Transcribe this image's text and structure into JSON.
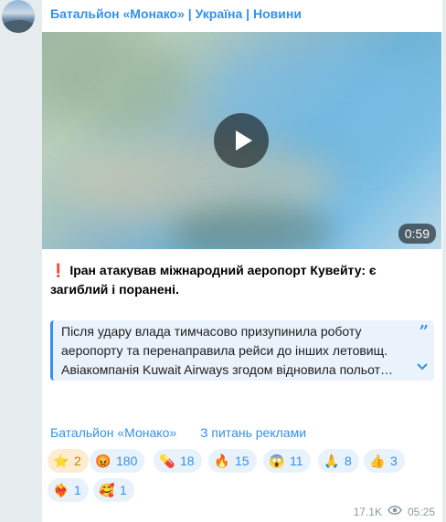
{
  "channel": {
    "name": "Батальйон «Монако» | Україна | Новини"
  },
  "video": {
    "duration": "0:59"
  },
  "post": {
    "headline_mark": "❗",
    "headline": "Іран атакував міжнародний аеропорт Кувейту: є загиблий і поранені.",
    "quote": "Після удару влада тимчасово призупинила роботу аеропорту та перенаправила рейси до інших летовищ. Авіакомпанія Kuwait Airways згодом відновила польот…"
  },
  "links": {
    "channel_link": "Батальйон «Монако»",
    "ads_link": "З питань реклами"
  },
  "reactions": [
    {
      "emoji": "⭐",
      "count": "2",
      "starred": true
    },
    {
      "emoji": "😡",
      "count": "180"
    },
    {
      "emoji": "💊",
      "count": "18"
    },
    {
      "emoji": "🔥",
      "count": "15"
    },
    {
      "emoji": "😱",
      "count": "11"
    },
    {
      "emoji": "🙏",
      "count": "8"
    },
    {
      "emoji": "👍",
      "count": "3"
    },
    {
      "emoji": "❤️‍🔥",
      "count": "1"
    },
    {
      "emoji": "🥰",
      "count": "1"
    }
  ],
  "meta": {
    "views": "17.1K",
    "time": "05:25"
  },
  "colors": {
    "accent": "#3390ec",
    "star_bg": "#fdecd2"
  }
}
